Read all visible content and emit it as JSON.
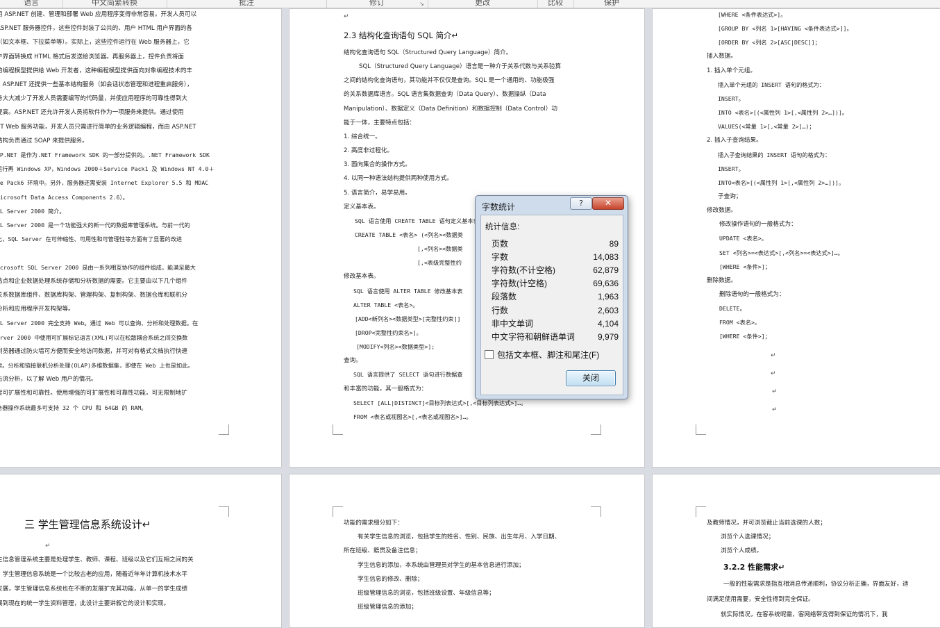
{
  "ribbon": {
    "groups": [
      {
        "label": "语言"
      },
      {
        "label": "中文简繁转换"
      },
      {
        "label": "批注"
      },
      {
        "label": "修订"
      },
      {
        "label": "更改"
      },
      {
        "label": "比较"
      },
      {
        "label": "保护"
      }
    ]
  },
  "pages": {
    "p1": {
      "lines": [
        "用 ASP.NET 创建、管理和部署 Web 应用程序变得非常容易。开发人员可以",
        "ASP.NET 服务器控件，这些控件封装了公共的、用户 HTML 用户界面的各",
        "（如文本框、下拉菜单等）。实际上，这些控件运行在 Web 服务器上，它",
        "户界面转换成 HTML 格式后发送给浏览器。再服务器上，控件负责将面",
        "的编程模型提供给 Web 开发者，这种编程模型提供面向对象编程技术的丰",
        "。ASP.NET 还提供一些基本结构服务（如会话状态管理和进程重启服务），",
        "务大大减少了开发人员需要编写的代码量，并使应用程序的可靠性得到大",
        "提高。ASP.NET 还允许开发人员将软件作为一项服务来提供。通过使用",
        "ET Web 服务功能，开发人员只需进行简单的业务逻辑编程，而由 ASP.NET",
        "结构负责通过 SOAP 来提供服务。",
        "SP.NET 是作为.NET Framework SDK 的一部分提供的。.NET Framework SDK",
        "运行再 Windows XP，Windows 2000＋Service Pack1 及 Windows NT 4.0＋",
        "ce Pack6 环境中。另外，服务器还需安装 Internet Explorer 5.5 和 MDAC",
        "Microsoft Data Access Components 2.6）。",
        "QL Server 2000 简介。",
        "QL Server 2000 是一个功能强大的新一代的数据库管理系统。与前一代的",
        "比，SQL Server 在可伸缩性、可用性和可管理性等方面有了显著的改进",
        "。",
        "icrosoft SQL Server 2000 是由一系列相互协作的组件组成，能满足最大",
        "站点和企业数据处理系统存储和分析数据的需要。它主要由以下几个组件",
        "关系数据库组件、数据库构架、管理构架、复制构架、数据仓库和联机分",
        "分析和应用程序开发构架等。",
        "QL Server 2000 完全支持 Web。通过 Web 可以查询、分析和处理数据。在",
        "erver 2000 中使用可扩展标记语言(XML)可以在松散耦合系统之间交换数",
        "浏览器通过防火墙可方便而安全地访问数据，并可对有格式文档执行快速",
        "索。分析和链接联机分析处理(OLAP)多维数据集，即使在 Web 上也是如此。",
        "击流分析，以了解 Web 用户的情况。",
        "度可扩展性和可靠性。使用增强的可扩展性和可靠性功能，可无限制地扩",
        "务器操作系统最多可支持 32 个 CPU 和 64GB 的 RAM。"
      ]
    },
    "p2": {
      "top_mark": "↵",
      "heading": "2.3 结构化查询语句 SQL 简介↵",
      "lines": [
        "结构化查询语句 SQL（Structured Query Language）简介。",
        "SQL（Structured Query Language）语言是一种介于关系代数与关系验算",
        "之间的结构化查询语句，其功能并不仅仅是查询。SQL 是一个通用的、功能极强",
        "的关系数据库语言。SQL 语言集数据查询（Data Query）、数据操纵（Data",
        "Manipulation）、数据定义（Data Definition）和数据控制（Data Control）功",
        "能于一体，主要特点包括：",
        "1. 综合统一。",
        "2. 高度非过程化。",
        "3. 面向集合的操作方式。",
        "4. 以同一种语法结构提供两种使用方式。",
        "5. 语言简介，易学易用。",
        "定义基本表。",
        "SQL 语言使用 CREATE TABLE 语句定义基本表，",
        "CREATE TABLE <表名> (<列名><数据类",
        "[,<列名><数据类",
        "[,<表级完整性约",
        "修改基本表。",
        "SQL 语言使用 ALTER TABLE 修改基本表",
        "ALTER TABLE <表名>。",
        "[ADD<新列名><数据类型>[完整性约束]]",
        "[DROP<完整性约束名>]。",
        "[MODIFY<列名><数据类型>];",
        "查询。",
        "SQL 语言提供了 SELECT 语句进行数据查",
        "和丰富的功能，其一般格式为：",
        "SELECT [ALL|DISTINCT]<目标列表达式>[,<目标列表达式>]…。",
        "FROM <表名或视图名>[,<表名或视图名>]…。"
      ]
    },
    "p3": {
      "lines": [
        "[WHERE <条件表达式>]。",
        "[GROUP BY <列名 1>[HAVING <条件表达式>]]。",
        "[ORDER BY <列名 2>[ASC|DESC]]；",
        "插入数据。",
        "1. 插入单个元组。",
        "插入单个元组的 INSERT 语句的格式为：",
        "INSERT。",
        "INTO <表名>[(<属性列 1>[,<属性列 2>…])]。",
        "VALUES(<常量 1>[,<常量 2>]…)；",
        "2. 插入子查询结果。",
        "插入子查询结果的 INSERT 语句的格式为：",
        "INSERT。",
        "INTO<表名>[(<属性列 1>[,<属性列 2>…])]。",
        "子查询；",
        "修改数据。",
        "修改操作语句的一般格式为：",
        "UPDATE <表名>。",
        "SET <列名>=<表达式>[,<列名>=<表达式>]…。",
        "[WHERE <条件>]；",
        "删除数据。",
        "删除语句的一般格式为：",
        "DELETE。",
        "FROM <表名>。",
        "[WHERE <条件>]；"
      ],
      "marks": [
        "↵",
        "↵",
        "↵",
        "↵"
      ]
    },
    "p4": {
      "heading": "三 学生管理信息系统设计↵",
      "mark": "↵",
      "lines": [
        "生信息管理系统主要是处理学生、教师、课程、班级以及它们互相之间的关",
        "。学生管理信息系统是一个比较古老的应用，随着近年年计算机技术水平",
        "发展，学生管理信息系统也在不断的发展扩充其功能，从单一的学生成绩",
        "展到现在的统一学生资料管理，此设计主要讲叙它的设计和实现。"
      ]
    },
    "p5": {
      "lines": [
        "功能的需求细分如下：",
        "有关学生信息的浏览，包括学生的姓名、性别、民族、出生年月、入学日期、",
        "所在班级、籍贯及备注信息；",
        "学生信息的添加，本系统由管理员对学生的基本信息进行添加；",
        "学生信息的修改、删除；",
        "班级管理信息的浏览，包括班级设置、年级信息等；",
        "班级管理信息的添加；"
      ]
    },
    "p6": {
      "lines": [
        "及教师情况，并可浏览截止当前选课的人数；",
        "浏览个人选课情况；",
        "浏览个人成绩。"
      ],
      "heading": "3.2.2 性能需求↵",
      "body": [
        "一般的性能需求是指互相消息传递顺利，协议分析正确，界面友好，适",
        "间满足使用需要，安全性得到完全保证。",
        "就实际情况，在客系统呢需，客网络带宽得到保证的情况下，我"
      ]
    }
  },
  "dialog": {
    "title": "字数统计",
    "help_label": "?",
    "close_x_label": "✕",
    "stats_heading": "统计信息:",
    "stats": [
      {
        "label": "页数",
        "value": "89"
      },
      {
        "label": "字数",
        "value": "14,083"
      },
      {
        "label": "字符数(不计空格)",
        "value": "62,879"
      },
      {
        "label": "字符数(计空格)",
        "value": "69,636"
      },
      {
        "label": "段落数",
        "value": "1,963"
      },
      {
        "label": "行数",
        "value": "2,603"
      },
      {
        "label": "非中文单词",
        "value": "4,104"
      },
      {
        "label": "中文字符和朝鲜语单词",
        "value": "9,979"
      }
    ],
    "include_label": "包括文本框、脚注和尾注(F)",
    "include_checked": false,
    "close_button": "关闭"
  }
}
